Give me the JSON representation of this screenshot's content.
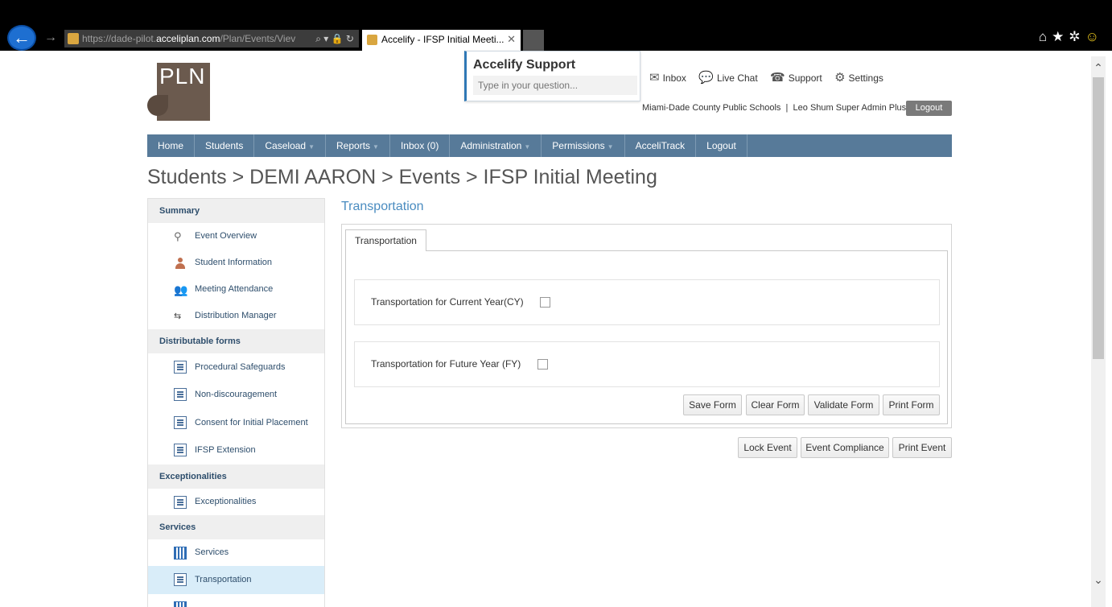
{
  "browser": {
    "url_prefix": "https://dade-pilot.",
    "url_domain": "acceliplan.com",
    "url_rest": "/Plan/Events/Viev",
    "tab_title": "Accelify - IFSP Initial Meeti...",
    "tab_close": "✕"
  },
  "logo": {
    "text": "PLN"
  },
  "support": {
    "title": "Accelify Support",
    "placeholder": "Type in your question..."
  },
  "toplinks": {
    "inbox": "Inbox",
    "live_chat": "Live Chat",
    "support": "Support",
    "settings": "Settings"
  },
  "user": {
    "org": "Miami-Dade County Public Schools",
    "separator": "|",
    "name": "Leo Shum Super Admin Plus",
    "logout": "Logout"
  },
  "nav": {
    "items": [
      {
        "label": "Home"
      },
      {
        "label": "Students"
      },
      {
        "label": "Caseload"
      },
      {
        "label": "Reports"
      },
      {
        "label": "Inbox (0)"
      },
      {
        "label": "Administration"
      },
      {
        "label": "Permissions"
      },
      {
        "label": "AcceliTrack"
      },
      {
        "label": "Logout"
      }
    ]
  },
  "breadcrumb": "Students > DEMI AARON > Events > IFSP Initial Meeting",
  "sidebar": {
    "summary": "Summary",
    "event_overview": "Event Overview",
    "student_information": "Student Information",
    "meeting_attendance": "Meeting Attendance",
    "distribution_manager": "Distribution Manager",
    "distributable_forms": "Distributable forms",
    "procedural_safeguards": "Procedural Safeguards",
    "non_discouragement": "Non-discouragement",
    "consent_initial_placement": "Consent for Initial Placement",
    "ifsp_extension": "IFSP Extension",
    "exceptionalities_section": "Exceptionalities",
    "exceptionalities_item": "Exceptionalities",
    "services_section": "Services",
    "services_item": "Services",
    "transportation_item": "Transportation"
  },
  "main": {
    "title": "Transportation",
    "tab": "Transportation",
    "field_cy": "Transportation for Current Year(CY)",
    "field_fy": "Transportation for Future Year (FY)",
    "cy_checked": false,
    "fy_checked": false,
    "buttons": {
      "save": "Save Form",
      "clear": "Clear Form",
      "validate": "Validate Form",
      "print": "Print Form",
      "lock_event": "Lock Event",
      "event_compliance": "Event Compliance",
      "print_event": "Print Event"
    }
  },
  "icons": {
    "back": "back-arrow-icon",
    "forward": "forward-arrow-icon",
    "home": "home-icon",
    "favorites": "star-icon",
    "tools": "gear-icon",
    "feedback": "smiley-icon"
  }
}
